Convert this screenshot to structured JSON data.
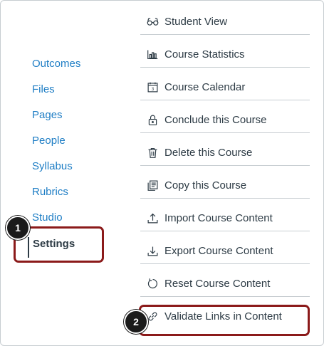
{
  "nav": {
    "items": [
      {
        "label": "Outcomes"
      },
      {
        "label": "Files"
      },
      {
        "label": "Pages"
      },
      {
        "label": "People"
      },
      {
        "label": "Syllabus"
      },
      {
        "label": "Rubrics"
      },
      {
        "label": "Studio"
      }
    ],
    "active": {
      "label": "Settings"
    }
  },
  "sidebar": {
    "buttons": [
      {
        "label": "Student View",
        "icon": "student-view-icon"
      },
      {
        "label": "Course Statistics",
        "icon": "statistics-icon"
      },
      {
        "label": "Course Calendar",
        "icon": "calendar-icon"
      },
      {
        "label": "Conclude this Course",
        "icon": "lock-icon"
      },
      {
        "label": "Delete this Course",
        "icon": "trash-icon"
      },
      {
        "label": "Copy this Course",
        "icon": "copy-icon"
      },
      {
        "label": "Import Course Content",
        "icon": "upload-icon"
      },
      {
        "label": "Export Course Content",
        "icon": "download-icon"
      },
      {
        "label": "Reset Course Content",
        "icon": "reset-icon"
      },
      {
        "label": "Validate Links in Content",
        "icon": "link-icon"
      }
    ]
  },
  "callouts": {
    "first": "1",
    "second": "2"
  },
  "colors": {
    "link": "#1f7ec5",
    "text": "#2d3b45",
    "highlight": "#8b1a1a",
    "divider": "#c7cdd1"
  }
}
